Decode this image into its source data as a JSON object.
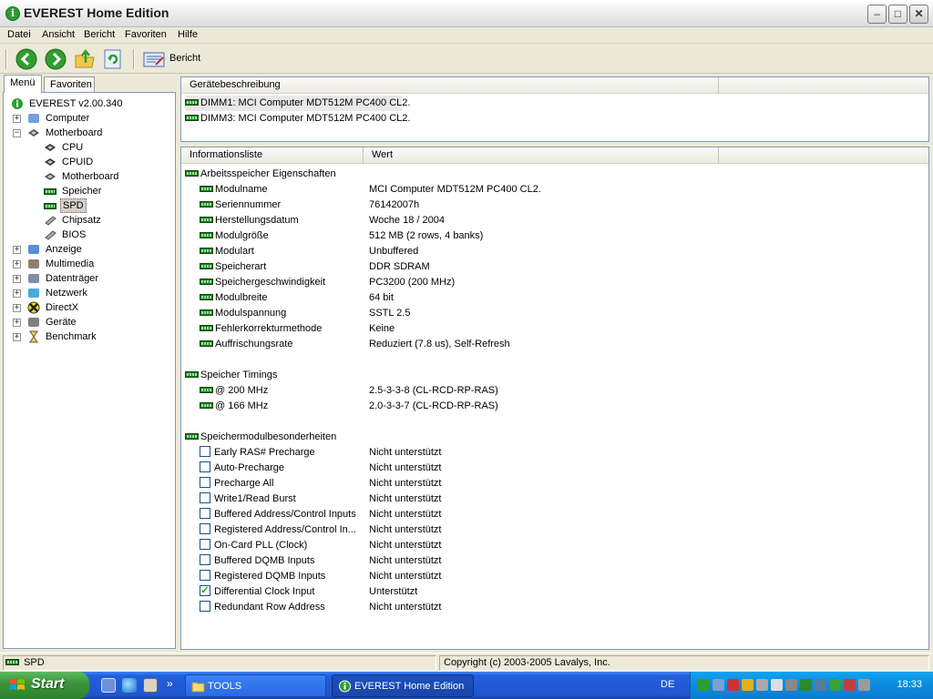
{
  "window": {
    "title": "EVEREST Home Edition"
  },
  "menu": [
    "Datei",
    "Ansicht",
    "Bericht",
    "Favoriten",
    "Hilfe"
  ],
  "toolbar": {
    "report_label": "Bericht"
  },
  "left_tabs": [
    "Menü",
    "Favoriten"
  ],
  "tree": [
    {
      "label": "EVEREST v2.00.340",
      "level": 0,
      "icon": "info-icon",
      "expander": ""
    },
    {
      "label": "Computer",
      "level": 1,
      "icon": "computer-icon",
      "expander": "+"
    },
    {
      "label": "Motherboard",
      "level": 1,
      "icon": "motherboard-icon",
      "expander": "-"
    },
    {
      "label": "CPU",
      "level": 2,
      "icon": "cpu-icon",
      "expander": ""
    },
    {
      "label": "CPUID",
      "level": 2,
      "icon": "cpu-icon",
      "expander": ""
    },
    {
      "label": "Motherboard",
      "level": 2,
      "icon": "motherboard-icon",
      "expander": ""
    },
    {
      "label": "Speicher",
      "level": 2,
      "icon": "memory-icon",
      "expander": ""
    },
    {
      "label": "SPD",
      "level": 2,
      "icon": "memory-icon",
      "expander": "",
      "selected": true
    },
    {
      "label": "Chipsatz",
      "level": 2,
      "icon": "chip-icon",
      "expander": ""
    },
    {
      "label": "BIOS",
      "level": 2,
      "icon": "chip-icon",
      "expander": ""
    },
    {
      "label": "Anzeige",
      "level": 1,
      "icon": "display-icon",
      "expander": "+"
    },
    {
      "label": "Multimedia",
      "level": 1,
      "icon": "multimedia-icon",
      "expander": "+"
    },
    {
      "label": "Datenträger",
      "level": 1,
      "icon": "disk-icon",
      "expander": "+"
    },
    {
      "label": "Netzwerk",
      "level": 1,
      "icon": "network-icon",
      "expander": "+"
    },
    {
      "label": "DirectX",
      "level": 1,
      "icon": "directx-icon",
      "expander": "+"
    },
    {
      "label": "Geräte",
      "level": 1,
      "icon": "devices-icon",
      "expander": "+"
    },
    {
      "label": "Benchmark",
      "level": 1,
      "icon": "hourglass-icon",
      "expander": "+"
    }
  ],
  "device_panel": {
    "header": "Gerätebeschreibung",
    "items": [
      "DIMM1: MCI Computer MDT512M PC400 CL2.",
      "DIMM3: MCI Computer MDT512M PC400 CL2."
    ]
  },
  "info_panel": {
    "headers": [
      "Informationsliste",
      "Wert"
    ],
    "sections": [
      {
        "title": "Arbeitsspeicher Eigenschaften",
        "rows": [
          {
            "k": "Modulname",
            "v": "MCI Computer MDT512M PC400 CL2."
          },
          {
            "k": "Seriennummer",
            "v": "76142007h"
          },
          {
            "k": "Herstellungsdatum",
            "v": "Woche 18 / 2004"
          },
          {
            "k": "Modulgröße",
            "v": "512 MB (2 rows, 4 banks)"
          },
          {
            "k": "Modulart",
            "v": "Unbuffered"
          },
          {
            "k": "Speicherart",
            "v": "DDR SDRAM"
          },
          {
            "k": "Speichergeschwindigkeit",
            "v": "PC3200 (200 MHz)"
          },
          {
            "k": "Modulbreite",
            "v": "64 bit"
          },
          {
            "k": "Modulspannung",
            "v": "SSTL 2.5"
          },
          {
            "k": "Fehlerkorrekturmethode",
            "v": "Keine"
          },
          {
            "k": "Auffrischungsrate",
            "v": "Reduziert (7.8 us), Self-Refresh"
          }
        ]
      },
      {
        "title": "Speicher Timings",
        "rows": [
          {
            "k": "@ 200 MHz",
            "v": "2.5-3-3-8  (CL-RCD-RP-RAS)"
          },
          {
            "k": "@ 166 MHz",
            "v": "2.0-3-3-7  (CL-RCD-RP-RAS)"
          }
        ]
      },
      {
        "title": "Speichermodulbesonderheiten",
        "checks": [
          {
            "k": "Early RAS# Precharge",
            "v": "Nicht unterstützt",
            "checked": false
          },
          {
            "k": "Auto-Precharge",
            "v": "Nicht unterstützt",
            "checked": false
          },
          {
            "k": "Precharge All",
            "v": "Nicht unterstützt",
            "checked": false
          },
          {
            "k": "Write1/Read Burst",
            "v": "Nicht unterstützt",
            "checked": false
          },
          {
            "k": "Buffered Address/Control Inputs",
            "v": "Nicht unterstützt",
            "checked": false
          },
          {
            "k": "Registered Address/Control In...",
            "v": "Nicht unterstützt",
            "checked": false
          },
          {
            "k": "On-Card PLL (Clock)",
            "v": "Nicht unterstützt",
            "checked": false
          },
          {
            "k": "Buffered DQMB Inputs",
            "v": "Nicht unterstützt",
            "checked": false
          },
          {
            "k": "Registered DQMB Inputs",
            "v": "Nicht unterstützt",
            "checked": false
          },
          {
            "k": "Differential Clock Input",
            "v": "Unterstützt",
            "checked": true
          },
          {
            "k": "Redundant Row Address",
            "v": "Nicht unterstützt",
            "checked": false
          }
        ]
      }
    ]
  },
  "status": {
    "left": "SPD",
    "right": "Copyright (c) 2003-2005 Lavalys, Inc."
  },
  "taskbar": {
    "start": "Start",
    "chevron": "»",
    "items": [
      {
        "label": "TOOLS",
        "icon": "folder-icon",
        "active": false
      },
      {
        "label": "EVEREST Home Edition",
        "icon": "everest-icon",
        "active": true
      }
    ],
    "lang": "DE",
    "clock": "18:33"
  }
}
